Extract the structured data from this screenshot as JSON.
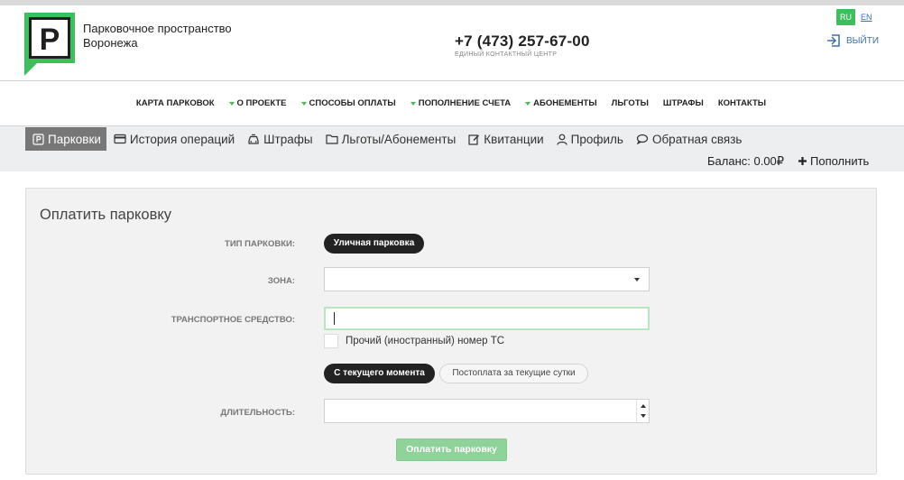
{
  "header": {
    "logo_letter": "P",
    "brand_line1": "Парковочное пространство",
    "brand_line2": "Воронежа",
    "phone": "+7 (473) 257-67-00",
    "phone_caption": "ЕДИНЫЙ КОНТАКТНЫЙ ЦЕНТР",
    "lang_ru": "RU",
    "lang_en": "EN",
    "logout": "ВЫЙТИ"
  },
  "mainnav": {
    "items": [
      {
        "label": "КАРТА ПАРКОВОК"
      },
      {
        "label": "О ПРОЕКТЕ"
      },
      {
        "label": "СПОСОБЫ ОПЛАТЫ"
      },
      {
        "label": "ПОПОЛНЕНИЕ СЧЕТА"
      },
      {
        "label": "АБОНЕМЕНТЫ"
      },
      {
        "label": "ЛЬГОТЫ"
      },
      {
        "label": "ШТРАФЫ"
      },
      {
        "label": "КОНТАКТЫ"
      }
    ]
  },
  "subnav": {
    "tabs": [
      {
        "label": "Парковки"
      },
      {
        "label": "История операций"
      },
      {
        "label": "Штрафы"
      },
      {
        "label": "Льготы/Абонементы"
      },
      {
        "label": "Квитанции"
      },
      {
        "label": "Профиль"
      },
      {
        "label": "Обратная связь"
      }
    ],
    "balance": "Баланс: 0.00₽",
    "topup": "Пополнить"
  },
  "form": {
    "title": "Оплатить парковку",
    "type_label": "ТИП ПАРКОВКИ:",
    "type_value": "Уличная парковка",
    "zone_label": "ЗОНА:",
    "vehicle_label": "ТРАНСПОРТНОЕ СРЕДСТВО:",
    "foreign_label": "Прочий (иностранный) номер ТС",
    "mode_current": "С текущего момента",
    "mode_postpay": "Постоплата за текущие сутки",
    "duration_label": "ДЛИТЕЛЬНОСТЬ:",
    "submit": "Оплатить парковку"
  },
  "colors": {
    "accent_green": "#3cc05c",
    "link_blue": "#3b6fb6",
    "active_tab": "#777777"
  }
}
